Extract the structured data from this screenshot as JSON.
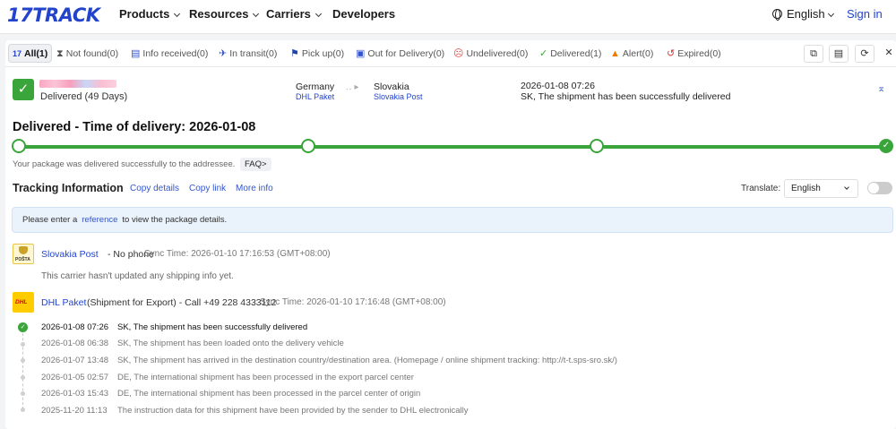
{
  "brand": {
    "logo_accent": "17",
    "logo_text": "TRACK"
  },
  "nav": {
    "items": [
      "Products",
      "Resources",
      "Carriers",
      "Developers"
    ],
    "language": "English",
    "signin": "Sign in"
  },
  "tabs": [
    {
      "label": "All(1)",
      "icon": "17-logo-icon",
      "active": true
    },
    {
      "label": "Not found(0)",
      "icon": "hourglass-icon"
    },
    {
      "label": "Info received(0)",
      "icon": "clipboard-icon"
    },
    {
      "label": "In transit(0)",
      "icon": "plane-icon"
    },
    {
      "label": "Pick up(0)",
      "icon": "flag-icon"
    },
    {
      "label": "Out for Delivery(0)",
      "icon": "truck-icon"
    },
    {
      "label": "Undelivered(0)",
      "icon": "sad-face-icon"
    },
    {
      "label": "Delivered(1)",
      "icon": "check-icon"
    },
    {
      "label": "Alert(0)",
      "icon": "warning-icon"
    },
    {
      "label": "Expired(0)",
      "icon": "history-icon"
    }
  ],
  "shipment": {
    "status_days": "Delivered (49 Days)",
    "origin_country": "Germany",
    "origin_carrier": "DHL Paket",
    "dest_country": "Slovakia",
    "dest_carrier": "Slovakia Post",
    "last_time": "2026-01-08 07:26",
    "last_desc": "SK, The shipment has been successfully delivered"
  },
  "delivered_title": "Delivered - Time of delivery: 2026-01-08",
  "progress_message": "Your package was delivered successfully to the addressee.",
  "faq_label": "FAQ>",
  "tracking": {
    "title": "Tracking Information",
    "links": [
      "Copy details",
      "Copy link",
      "More info"
    ],
    "translate_label": "Translate:",
    "translate_value": "English"
  },
  "notice": {
    "before": "Please enter a",
    "link": "reference",
    "after": "to view the package details."
  },
  "carriers": {
    "slovakia": {
      "name": "Slovakia Post",
      "extra": " - No phone",
      "sync": "Sync Time: 2026-01-10 17:16:53 (GMT+08:00)",
      "no_info": "This carrier hasn't updated any shipping info yet.",
      "logo_text": "POŠTA"
    },
    "dhl": {
      "name": "DHL Paket",
      "extra": "(Shipment for Export) - Call +49 228 4333112",
      "sync": "Sync Time: 2026-01-10 17:16:48 (GMT+08:00)",
      "logo_text": "DHL"
    }
  },
  "events": [
    {
      "time": "2026-01-08 07:26",
      "desc": "SK, The shipment has been successfully delivered"
    },
    {
      "time": "2026-01-08 06:38",
      "desc": "SK, The shipment has been loaded onto the delivery vehicle"
    },
    {
      "time": "2026-01-07 13:48",
      "desc": "SK, The shipment has arrived in the destination country/destination area. (Homepage / online shipment tracking: http://t-t.sps-sro.sk/)"
    },
    {
      "time": "2026-01-05 02:57",
      "desc": "DE, The international shipment has been processed in the export parcel center"
    },
    {
      "time": "2026-01-03 15:43",
      "desc": "DE, The international shipment has been processed in the parcel center of origin"
    },
    {
      "time": "2025-11-20 11:13",
      "desc": "The instruction data for this shipment have been provided by the sender to DHL electronically"
    }
  ],
  "colors": {
    "brand_blue": "#2244cc",
    "success_green": "#3aa53a",
    "link_blue": "#3355cc"
  }
}
